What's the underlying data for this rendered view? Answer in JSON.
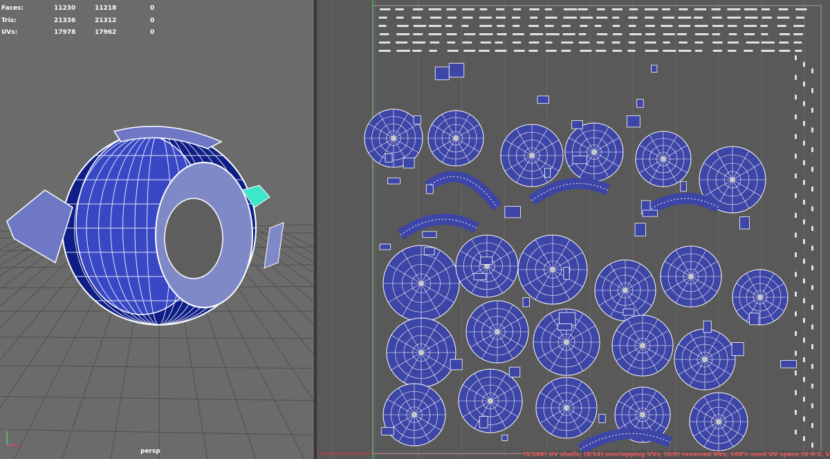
{
  "viewport": {
    "camera": "persp",
    "stats": [
      {
        "label": "Faces:",
        "v1": "11230",
        "v2": "11218",
        "v3": "0"
      },
      {
        "label": "Tris:",
        "v1": "21336",
        "v2": "21312",
        "v3": "0"
      },
      {
        "label": "UVs:",
        "v1": "17978",
        "v2": "17962",
        "v3": "0"
      }
    ],
    "axis": {
      "y": "y",
      "x": "x"
    }
  },
  "uv_editor": {
    "status": "(0/548) UV shells, (0/14) overlapping UVs, (0/0) reversed UVs, 100% used UV space (U  0-1, V"
  },
  "colors": {
    "viewport_bg": "#6b6b6b",
    "uv_bg": "#595959",
    "uv_fill": "#3d45a6",
    "wire": "#ffffff",
    "model_dark": "#0f1e86",
    "selection": "#3fe7c9",
    "status_text": "#e35a5a"
  }
}
